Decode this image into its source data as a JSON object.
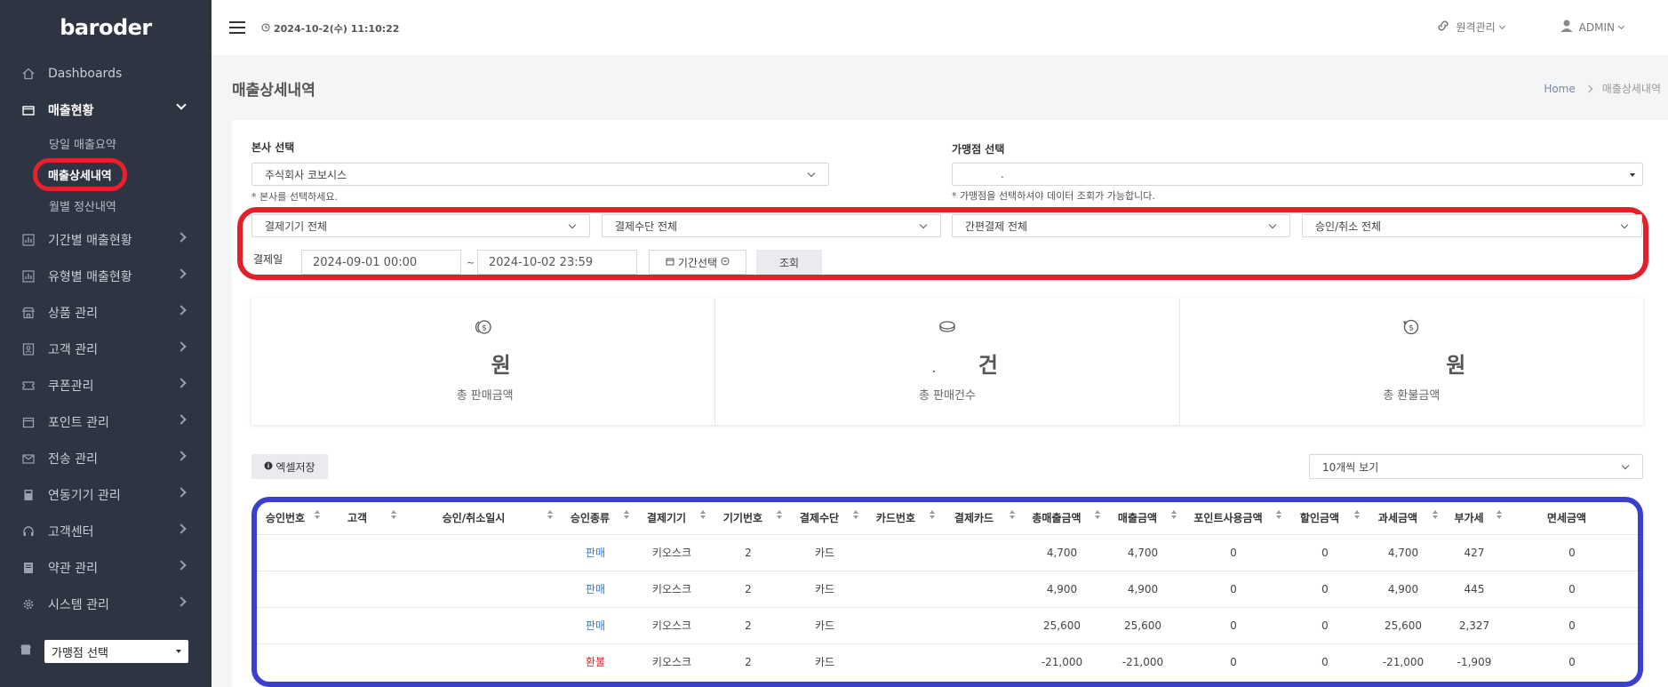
{
  "app": {
    "logo_text": "baroder"
  },
  "header": {
    "datetime": "2024-10-2(수) 11:10:22",
    "remote_label": "원격관리",
    "user_label": "ADMIN"
  },
  "sidebar": {
    "items": [
      {
        "label": "Dashboards",
        "icon": "home-icon"
      },
      {
        "label": "매출현황",
        "icon": "wallet-icon",
        "open": true
      },
      {
        "label": "기간별 매출현황",
        "icon": "bar-chart-icon"
      },
      {
        "label": "유형별 매출현황",
        "icon": "bar-chart-icon"
      },
      {
        "label": "상품 관리",
        "icon": "store-icon"
      },
      {
        "label": "고객 관리",
        "icon": "contact-icon"
      },
      {
        "label": "쿠폰관리",
        "icon": "ticket-icon"
      },
      {
        "label": "포인트 관리",
        "icon": "folder-icon"
      },
      {
        "label": "전송 관리",
        "icon": "mail-icon"
      },
      {
        "label": "연동기기 관리",
        "icon": "calculator-icon"
      },
      {
        "label": "고객센터",
        "icon": "headset-icon"
      },
      {
        "label": "약관 관리",
        "icon": "book-icon"
      },
      {
        "label": "시스템 관리",
        "icon": "gear-icon"
      }
    ],
    "sub_items": [
      "당일 매출요약",
      "매출상세내역",
      "월별 정산내역"
    ],
    "store_select": "가맹점 선택"
  },
  "page": {
    "title": "매출상세내역",
    "breadcrumb_home": "Home",
    "breadcrumb_current": "매출상세내역"
  },
  "filters": {
    "hq_label": "본사 선택",
    "hq_value": "주식회사 코보시스",
    "hq_hint": "* 본사를 선택하세요.",
    "store_label": "가맹점 선택",
    "store_value": ".",
    "store_hint": "* 가맹점을 선택하셔야 데이터 조회가 가능합니다.",
    "device": "결제기기 전체",
    "method": "결제수단 전체",
    "easy_pay": "간편결제 전체",
    "approval": "승인/취소 전체",
    "date_label": "결제일",
    "date_from": "2024-09-01 00:00",
    "date_sep": "~",
    "date_to": "2024-10-02 23:59",
    "period_button": "기간선택",
    "search_button": "조회"
  },
  "stats": [
    {
      "value": "원",
      "label": "총 판매금액",
      "icon": "coins-icon"
    },
    {
      "value": "건",
      "prefix": ".",
      "label": "총 판매건수",
      "icon": "coin-stack-icon"
    },
    {
      "value": "원",
      "label": "총 환불금액",
      "icon": "refund-coin-icon"
    }
  ],
  "table": {
    "excel_button": "엑셀저장",
    "page_size": "10개씩 보기",
    "columns": [
      "승인번호",
      "고객",
      "승인/취소일시",
      "승인종류",
      "결제기기",
      "기기번호",
      "결제수단",
      "카드번호",
      "결제카드",
      "총매출금액",
      "매출금액",
      "포인트사용금액",
      "할인금액",
      "과세금액",
      "부가세",
      "면세금액"
    ],
    "rows": [
      [
        "",
        "",
        "",
        "판매",
        "키오스크",
        "2",
        "카드",
        "",
        "",
        "4,700",
        "4,700",
        "0",
        "0",
        "4,700",
        "427",
        "0"
      ],
      [
        "",
        "",
        "",
        "판매",
        "키오스크",
        "2",
        "카드",
        "",
        "",
        "4,900",
        "4,900",
        "0",
        "0",
        "4,900",
        "445",
        "0"
      ],
      [
        "",
        "",
        "",
        "판매",
        "키오스크",
        "2",
        "카드",
        "",
        "",
        "25,600",
        "25,600",
        "0",
        "0",
        "25,600",
        "2,327",
        "0"
      ],
      [
        "",
        "",
        "",
        "환불",
        "키오스크",
        "2",
        "카드",
        "",
        "",
        "-21,000",
        "-21,000",
        "0",
        "0",
        "-21,000",
        "-1,909",
        "0"
      ]
    ]
  },
  "colors": {
    "sidebar_bg": "#2e3542",
    "highlight_red": "#e3202a",
    "highlight_blue": "#3a3fcf",
    "sale_blue": "#2a7bd8"
  }
}
